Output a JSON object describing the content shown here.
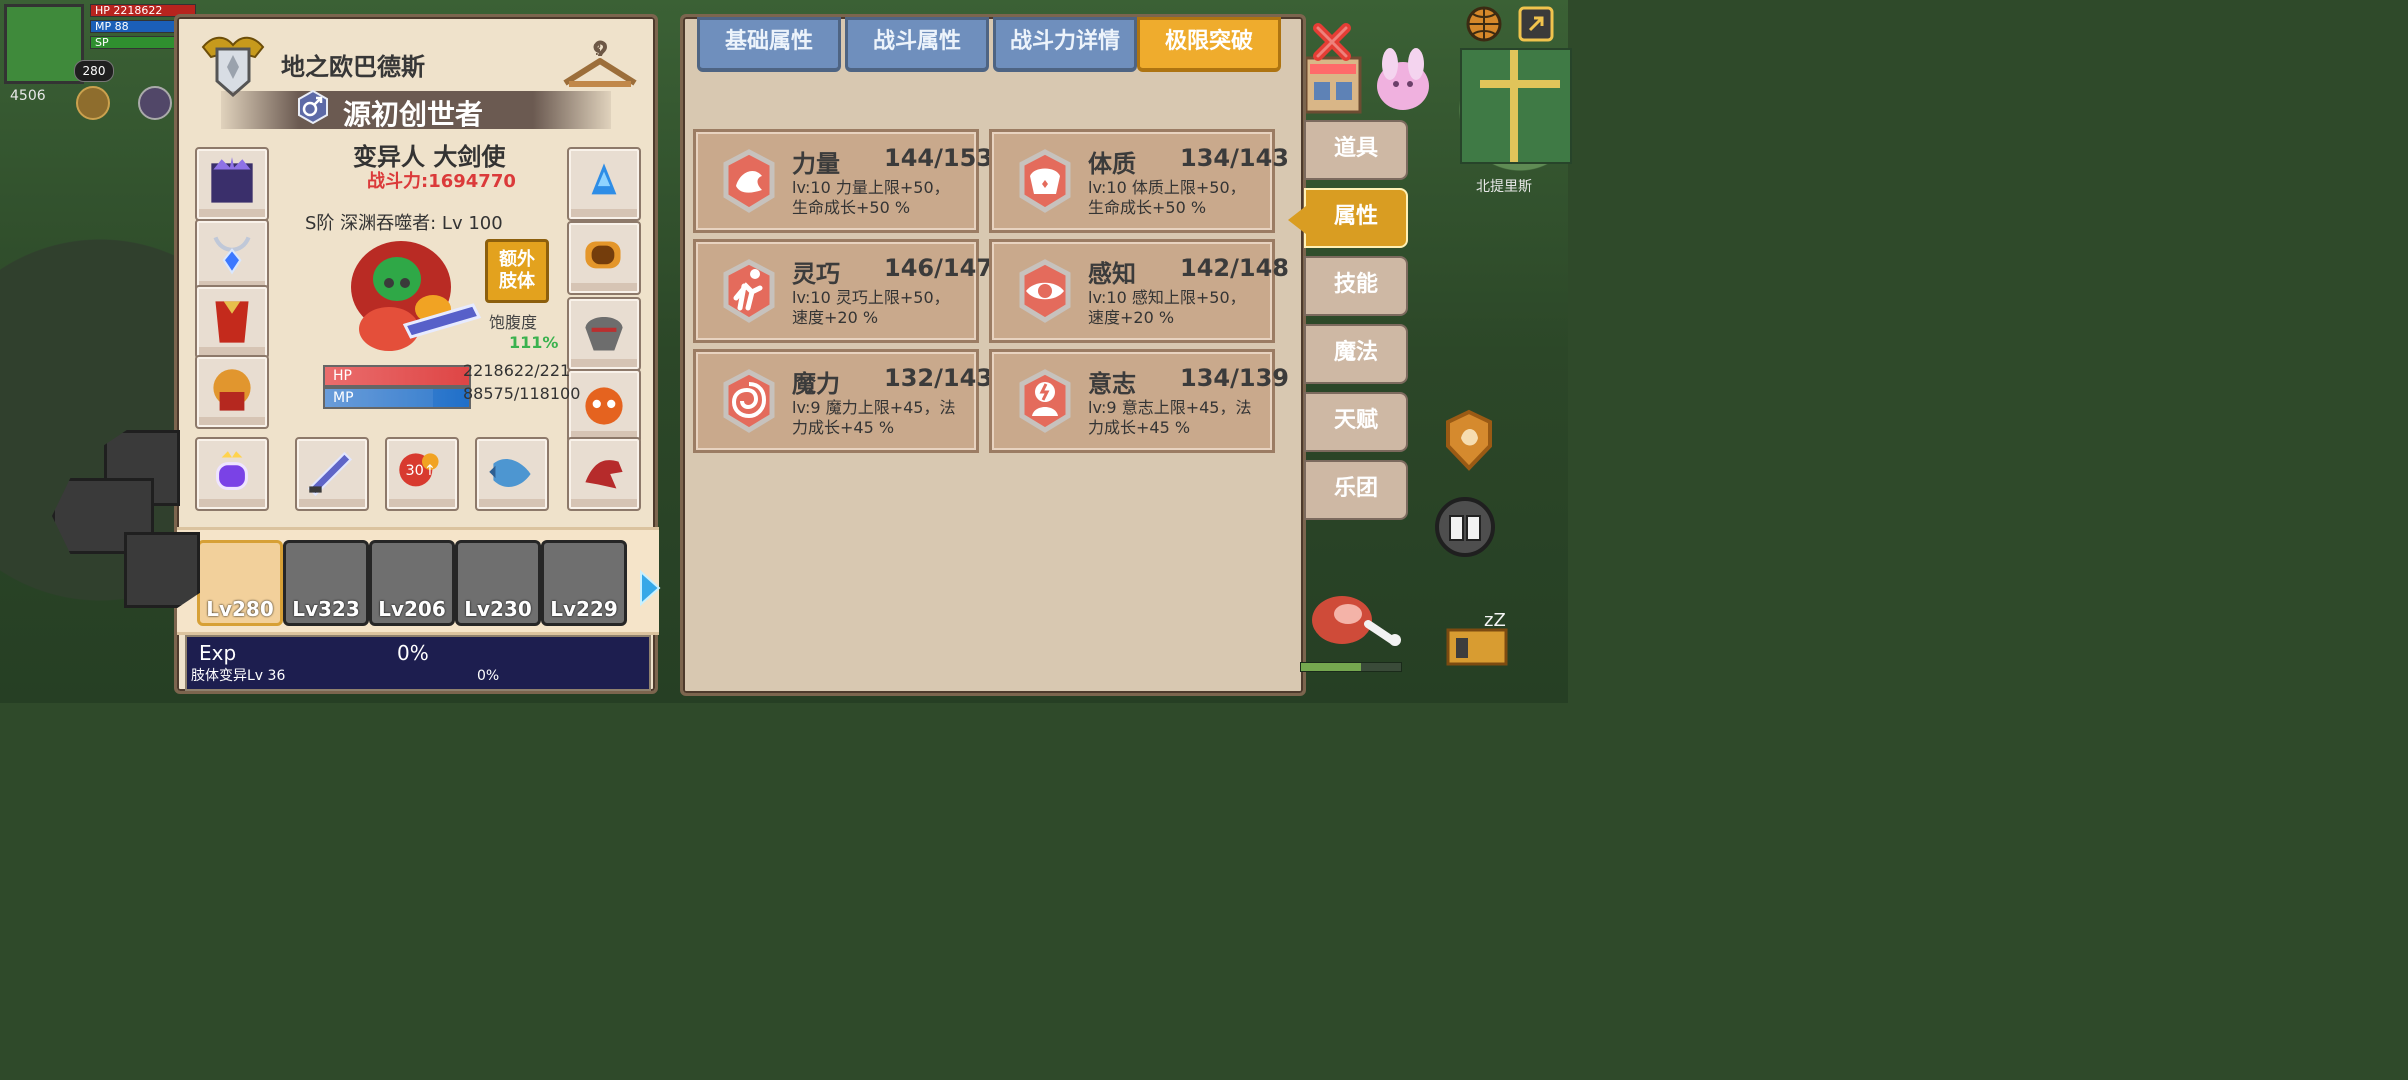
{
  "hud": {
    "player_level": "280",
    "hp_label": "HP",
    "hp_value": "2218622",
    "mp_label": "MP",
    "mp_value": "88",
    "sp_label": "SP",
    "resource_value": "4506"
  },
  "map": {
    "location_name": "北提里斯"
  },
  "character_panel": {
    "guild_name": "地之欧巴德斯",
    "class_title": "源初创世者",
    "race_job": "变异人 大剑使",
    "combat_power": "战斗力:1694770",
    "rank_line": "S阶 深渊吞噬者: Lv 100",
    "extra_limb_button": "额外\n肢体",
    "hunger_label": "饱腹度",
    "hunger_value": "111%",
    "hp_bar_label": "HP",
    "mp_bar_label": "MP",
    "hp_text": "2218622/221",
    "mp_text": "88575/118100",
    "mp_fill": 0.75
  },
  "party": {
    "members": [
      {
        "level": "Lv280"
      },
      {
        "level": "Lv323"
      },
      {
        "level": "Lv206"
      },
      {
        "level": "Lv230"
      },
      {
        "level": "Lv229"
      }
    ]
  },
  "progress": {
    "exp_label": "Exp",
    "exp_value": "0%",
    "mutation_label": "肢体变异Lv 36",
    "mutation_value": "0%"
  },
  "tabs": {
    "basic": "基础属性",
    "combat": "战斗属性",
    "power_detail": "战斗力详情",
    "limit_break": "极限突破"
  },
  "stats": [
    {
      "name": "力量",
      "value": "144/153",
      "desc": "lv:10 力量上限+50，生命成长+50 %"
    },
    {
      "name": "体质",
      "value": "134/143",
      "desc": "lv:10 体质上限+50，生命成长+50 %"
    },
    {
      "name": "灵巧",
      "value": "146/147",
      "desc": "lv:10 灵巧上限+50，速度+20 %"
    },
    {
      "name": "感知",
      "value": "142/148",
      "desc": "lv:10 感知上限+50，速度+20 %"
    },
    {
      "name": "魔力",
      "value": "132/143",
      "desc": "lv:9 魔力上限+45，法力成长+45 %"
    },
    {
      "name": "意志",
      "value": "134/139",
      "desc": "lv:9 意志上限+45，法力成长+45 %"
    }
  ],
  "side_menu": {
    "items": [
      "道具",
      "属性",
      "技能",
      "魔法",
      "天赋",
      "乐团"
    ]
  },
  "colors": {
    "accent": "#efac2d",
    "blue_tab": "#6f8fbd",
    "panel": "#efe2cb",
    "stat_card": "#c9a98c"
  }
}
